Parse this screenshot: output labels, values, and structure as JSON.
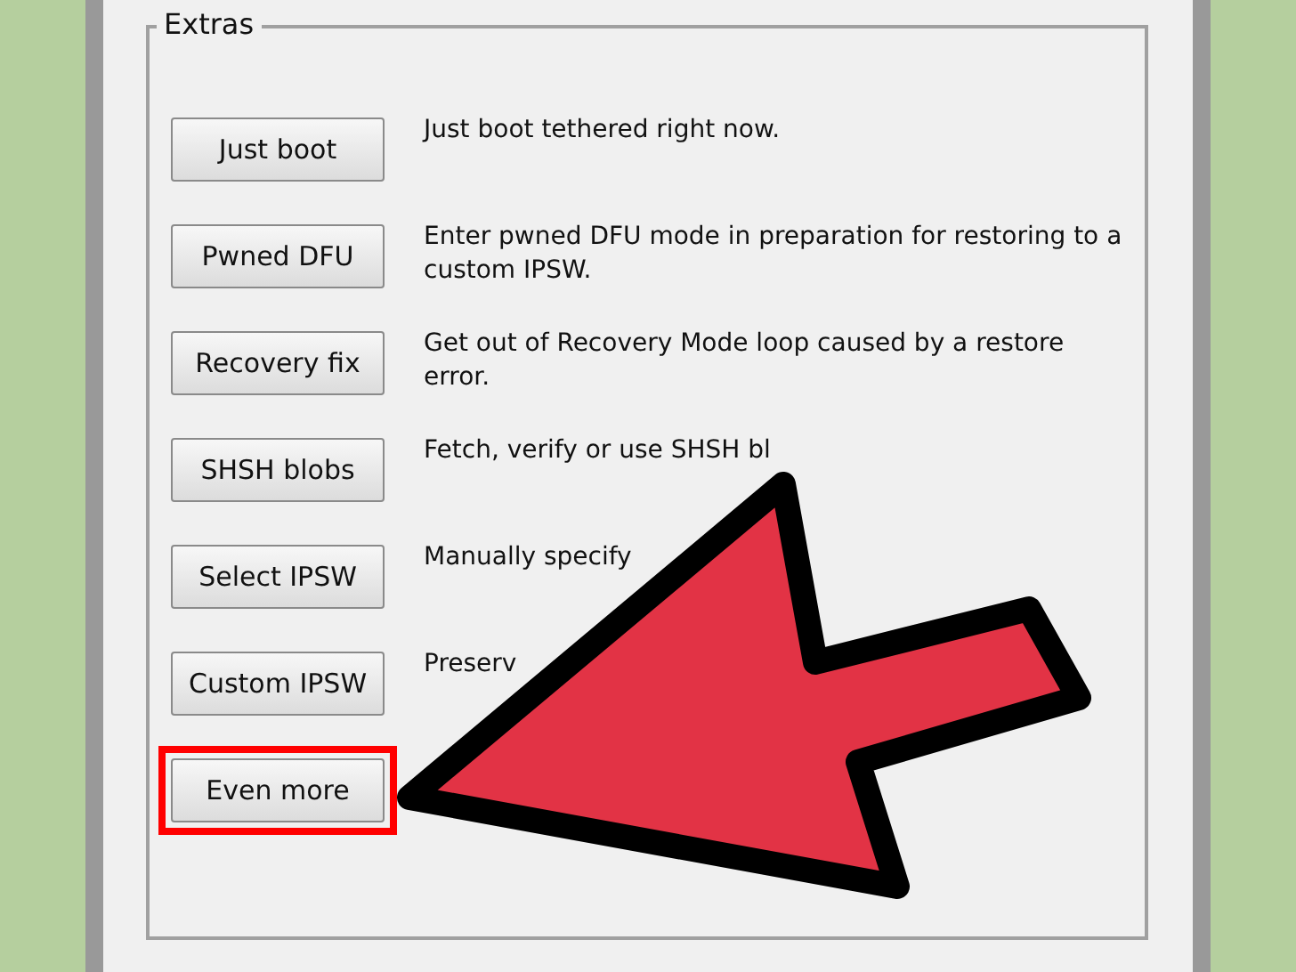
{
  "group": {
    "title": "Extras"
  },
  "rows": [
    {
      "button": "Just boot",
      "description": "Just boot tethered right now.",
      "highlighted": false
    },
    {
      "button": "Pwned DFU",
      "description": "Enter pwned DFU mode in preparation for restoring to a custom IPSW.",
      "highlighted": false
    },
    {
      "button": "Recovery fix",
      "description": "Get out of Recovery Mode loop caused by a restore error.",
      "highlighted": false
    },
    {
      "button": "SHSH blobs",
      "description": "Fetch, verify or use SHSH bl",
      "highlighted": false
    },
    {
      "button": "Select IPSW",
      "description": "Manually specify",
      "highlighted": false
    },
    {
      "button": "Custom IPSW",
      "description": "Preserv",
      "highlighted": false
    },
    {
      "button": "Even more",
      "highlighted": true
    }
  ]
}
